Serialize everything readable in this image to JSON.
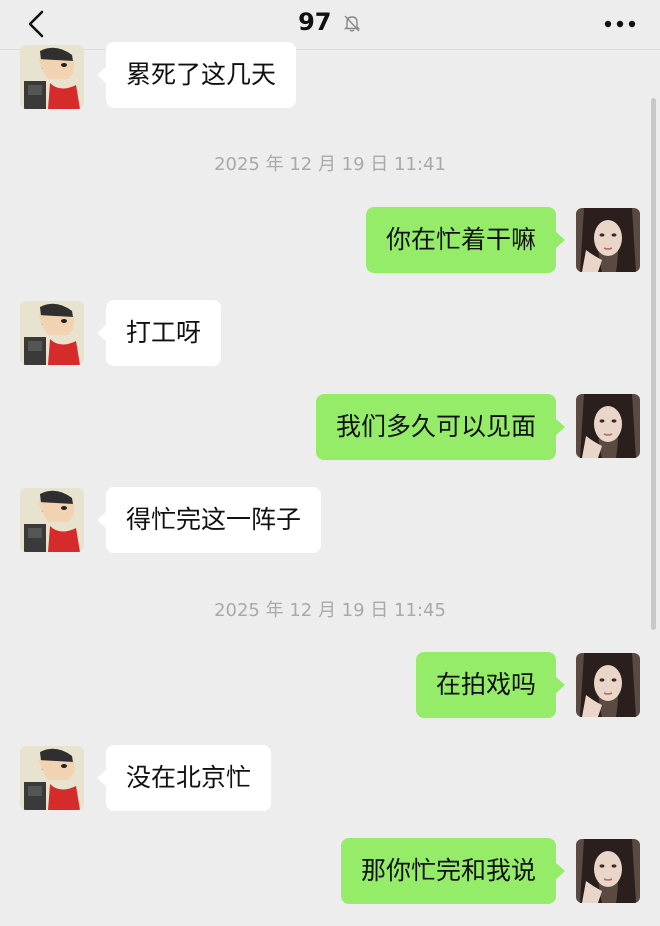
{
  "header": {
    "title": "97",
    "mute_icon": "bell-off-icon",
    "back_icon": "chevron-left-icon",
    "more_icon": "more-dots-icon"
  },
  "colors": {
    "background": "#ededed",
    "outgoing_bubble": "#95ec69",
    "incoming_bubble": "#ffffff",
    "timestamp_text": "#a9a9a9"
  },
  "chat": {
    "timestamps": [
      "2025 年 12 月 19 日 11:41",
      "2025 年 12 月 19 日 11:45"
    ],
    "messages": [
      {
        "from": "contact",
        "text": "累死了这几天"
      },
      {
        "from": "me",
        "text": "你在忙着干嘛"
      },
      {
        "from": "contact",
        "text": "打工呀"
      },
      {
        "from": "me",
        "text": "我们多久可以见面"
      },
      {
        "from": "contact",
        "text": "得忙完这一阵子"
      },
      {
        "from": "me",
        "text": "在拍戏吗"
      },
      {
        "from": "contact",
        "text": "没在北京忙"
      },
      {
        "from": "me",
        "text": "那你忙完和我说"
      }
    ]
  }
}
